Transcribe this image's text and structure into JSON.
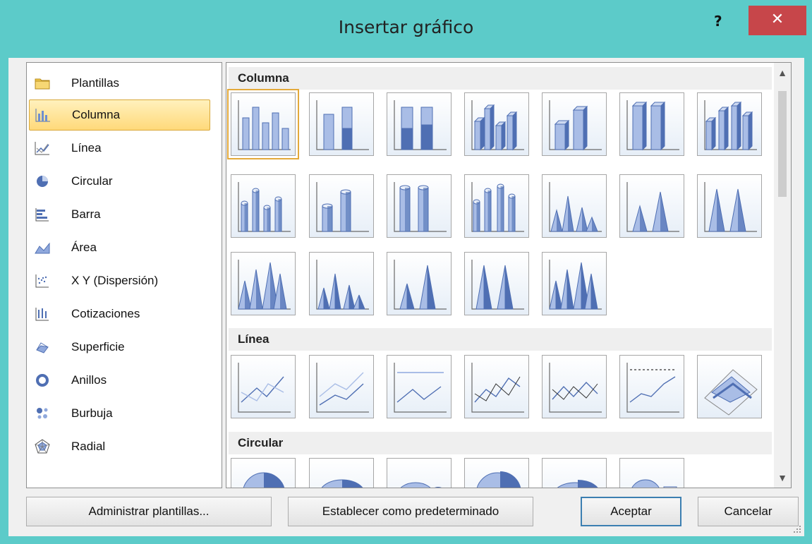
{
  "title": "Insertar gráfico",
  "help_label": "?",
  "close_label": "✕",
  "sidebar": {
    "items": [
      {
        "label": "Plantillas",
        "icon": "folder-icon",
        "selected": false
      },
      {
        "label": "Columna",
        "icon": "column-chart-icon",
        "selected": true
      },
      {
        "label": "Línea",
        "icon": "line-chart-icon",
        "selected": false
      },
      {
        "label": "Circular",
        "icon": "pie-chart-icon",
        "selected": false
      },
      {
        "label": "Barra",
        "icon": "bar-chart-icon",
        "selected": false
      },
      {
        "label": "Área",
        "icon": "area-chart-icon",
        "selected": false
      },
      {
        "label": "X Y (Dispersión)",
        "icon": "scatter-chart-icon",
        "selected": false
      },
      {
        "label": "Cotizaciones",
        "icon": "stock-chart-icon",
        "selected": false
      },
      {
        "label": "Superficie",
        "icon": "surface-chart-icon",
        "selected": false
      },
      {
        "label": "Anillos",
        "icon": "doughnut-chart-icon",
        "selected": false
      },
      {
        "label": "Burbuja",
        "icon": "bubble-chart-icon",
        "selected": false
      },
      {
        "label": "Radial",
        "icon": "radar-chart-icon",
        "selected": false
      }
    ]
  },
  "gallery": {
    "sections": [
      {
        "label": "Columna"
      },
      {
        "label": "Línea"
      },
      {
        "label": "Circular"
      }
    ]
  },
  "buttons": {
    "manage": "Administrar plantillas...",
    "set_default": "Establecer como predeterminado",
    "ok": "Aceptar",
    "cancel": "Cancelar"
  },
  "colors": {
    "frame": "#5ccbc9",
    "close": "#c7464a",
    "selection": "#ffd97a",
    "chart_blue": "#4f6fb3"
  }
}
